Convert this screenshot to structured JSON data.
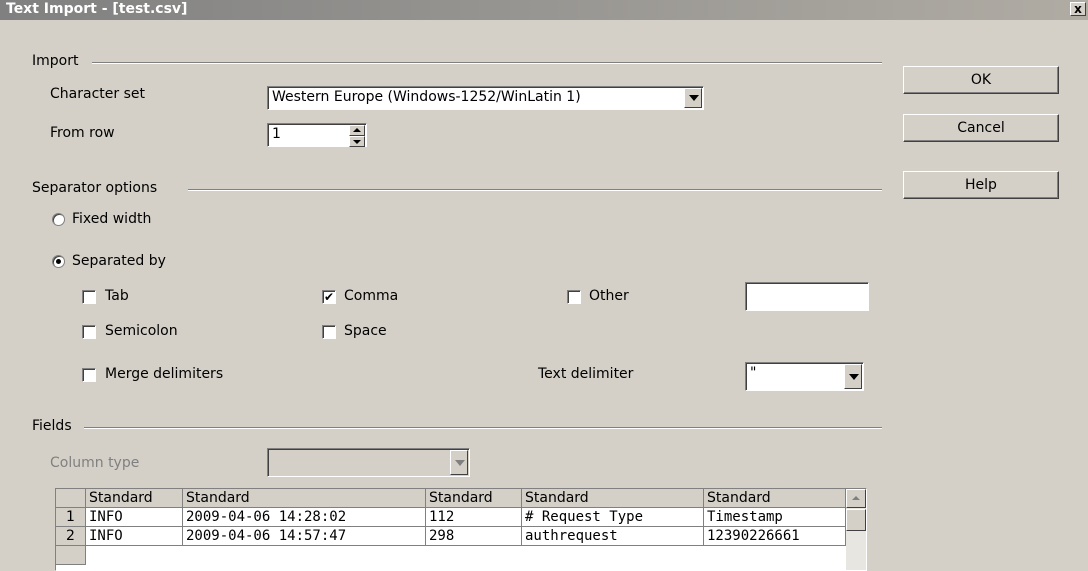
{
  "window": {
    "title": "Text Import - [test.csv]",
    "close_label": "x"
  },
  "import": {
    "group_label": "Import",
    "charset_label": "Character set",
    "charset_value": "Western Europe (Windows-1252/WinLatin 1)",
    "from_row_label": "From row",
    "from_row_value": "1"
  },
  "separator": {
    "group_label": "Separator options",
    "fixed_width_label": "Fixed width",
    "separated_by_label": "Separated by",
    "tab_label": "Tab",
    "comma_label": "Comma",
    "other_label": "Other",
    "semicolon_label": "Semicolon",
    "space_label": "Space",
    "merge_label": "Merge delimiters",
    "text_delim_label": "Text delimiter",
    "text_delim_value": "\"",
    "other_value": "",
    "checked": {
      "tab": false,
      "comma": true,
      "other": false,
      "semicolon": false,
      "space": false,
      "merge": false
    },
    "selected_mode": "separated"
  },
  "fields": {
    "group_label": "Fields",
    "column_type_label": "Column type",
    "column_type_value": "",
    "headers": [
      "Standard",
      "Standard",
      "Standard",
      "Standard",
      "Standard"
    ],
    "rows": [
      {
        "num": "1",
        "cells": [
          "INFO",
          "2009-04-06 14:28:02",
          "112",
          "# Request Type",
          "Timestamp"
        ]
      },
      {
        "num": "2",
        "cells": [
          "INFO",
          "2009-04-06 14:57:47",
          "298",
          "authrequest",
          "12390226661"
        ]
      }
    ]
  },
  "buttons": {
    "ok": "OK",
    "cancel": "Cancel",
    "help": "Help"
  },
  "icons": {
    "check_mark": "✔",
    "close": "x"
  }
}
